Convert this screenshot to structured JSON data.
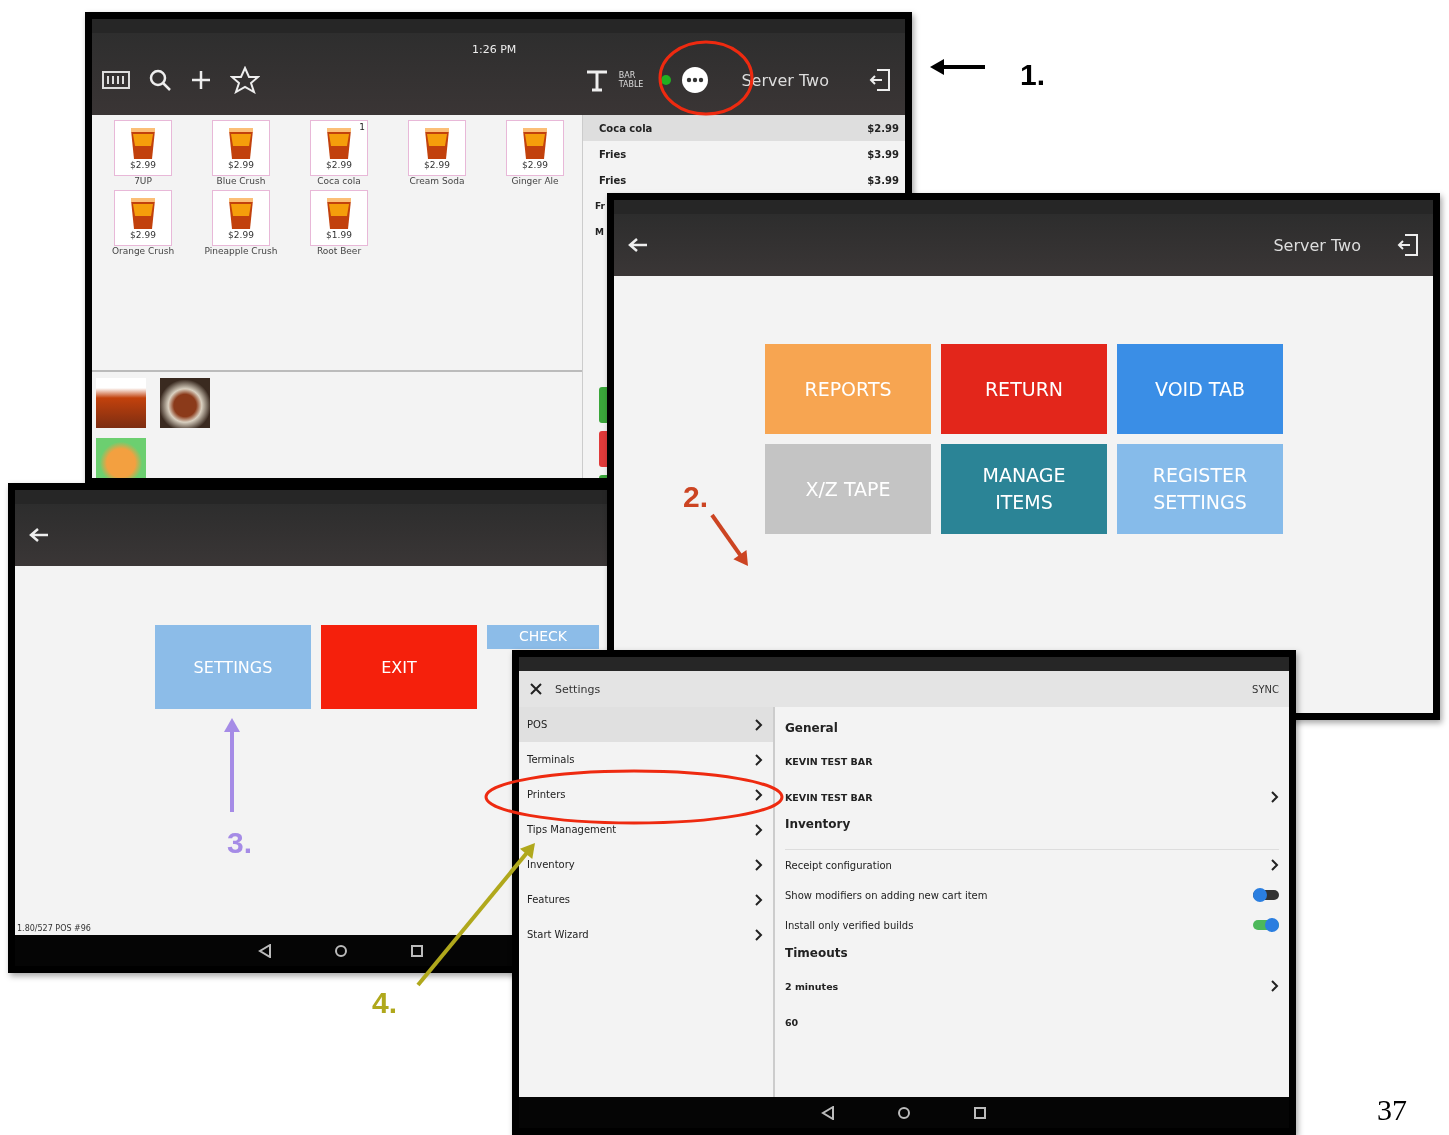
{
  "pos_screen": {
    "time": "1:26 PM",
    "table_labels": [
      "BAR",
      "TABLE"
    ],
    "user": "Server Two",
    "products": [
      {
        "name": "7UP",
        "price": "$2.99"
      },
      {
        "name": "Blue Crush",
        "price": "$2.99"
      },
      {
        "name": "Coca cola",
        "price": "$2.99",
        "badge": "1"
      },
      {
        "name": "Cream Soda",
        "price": "$2.99"
      },
      {
        "name": "Ginger Ale",
        "price": "$2.99"
      },
      {
        "name": "Orange Crush",
        "price": "$2.99"
      },
      {
        "name": "Pineapple Crush",
        "price": "$2.99"
      },
      {
        "name": "Root Beer",
        "price": "$1.99"
      }
    ],
    "order": [
      {
        "name": "Coca cola",
        "price": "$2.99",
        "selected": true
      },
      {
        "name": "Fries",
        "price": "$3.99",
        "selected": false
      },
      {
        "name": "Fries",
        "price": "$3.99",
        "selected": false
      },
      {
        "name": "Fr",
        "selected": false
      },
      {
        "name": "M",
        "selected": false
      }
    ]
  },
  "admin_menu": {
    "user": "Server Two",
    "buttons": [
      {
        "label": "REPORTS",
        "color": "#f7a551"
      },
      {
        "label": "RETURN",
        "color": "#e3261b"
      },
      {
        "label": "VOID TAB",
        "color": "#3a8ee6"
      },
      {
        "label": "X/Z TAPE",
        "color": "#c4c4c4"
      },
      {
        "label": "MANAGE ITEMS",
        "color": "#2b8496"
      },
      {
        "label": "REGISTER SETTINGS",
        "color": "#86bbea"
      }
    ]
  },
  "register_menu": {
    "footer": "1.80/527 POS #96",
    "buttons": [
      {
        "label": "SETTINGS",
        "color": "#8cbce8"
      },
      {
        "label": "EXIT",
        "color": "#f5200c"
      },
      {
        "label": "CHECK",
        "color": "#8cbce8"
      }
    ]
  },
  "settings_screen": {
    "title": "Settings",
    "action": "SYNC",
    "sidebar": [
      {
        "label": "POS",
        "selected": true
      },
      {
        "label": "Terminals",
        "selected": false
      },
      {
        "label": "Printers",
        "selected": false
      },
      {
        "label": "Tips Management",
        "selected": false
      },
      {
        "label": "Inventory",
        "selected": false
      },
      {
        "label": "Features",
        "selected": false
      },
      {
        "label": "Start Wizard",
        "selected": false
      }
    ],
    "sections": [
      {
        "title": "General",
        "rows": [
          {
            "kind": "value",
            "value": "KEVIN TEST BAR"
          },
          {
            "kind": "nav_value",
            "value": "KEVIN TEST BAR"
          }
        ]
      },
      {
        "title": "Inventory",
        "rows": [
          {
            "kind": "spacer"
          },
          {
            "kind": "link",
            "label": "Receipt configuration"
          },
          {
            "kind": "toggle",
            "label": "Show modifiers on adding new cart item",
            "on": false
          },
          {
            "kind": "toggle",
            "label": "Install only verified builds",
            "on": true
          }
        ]
      },
      {
        "title": "Timeouts",
        "rows": [
          {
            "kind": "nav_value",
            "value": "2 minutes"
          },
          {
            "kind": "value",
            "value": "60"
          }
        ]
      }
    ]
  },
  "callouts": [
    {
      "label": "1.",
      "color": "#000000"
    },
    {
      "label": "2.",
      "color": "#cc4422"
    },
    {
      "label": "3.",
      "color": "#a58be6"
    },
    {
      "label": "4.",
      "color": "#b0a81c"
    }
  ],
  "page_number": "37"
}
